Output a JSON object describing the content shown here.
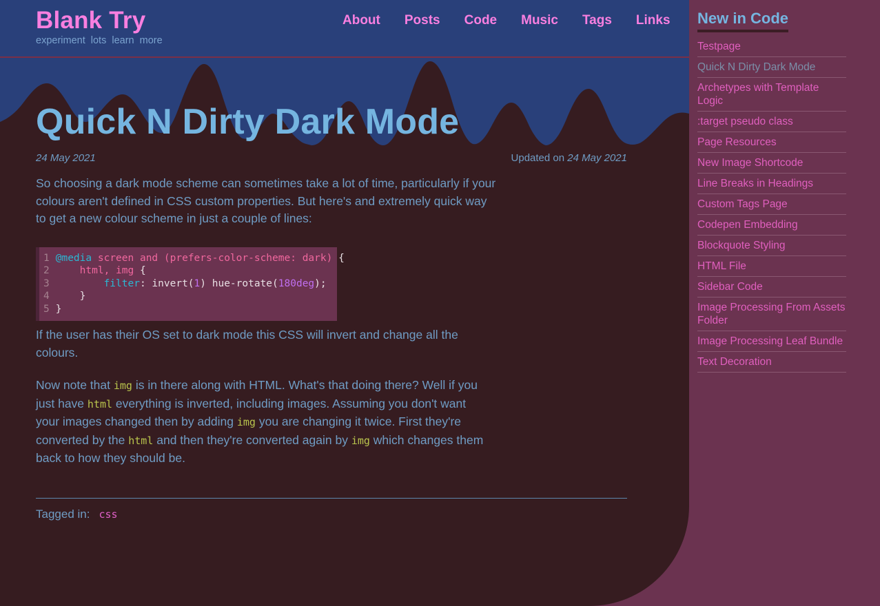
{
  "site": {
    "title": "Blank Try",
    "tagline": "experiment  lots  learn  more",
    "nav": [
      {
        "label": "About"
      },
      {
        "label": "Posts"
      },
      {
        "label": "Code"
      },
      {
        "label": "Music"
      },
      {
        "label": "Tags"
      },
      {
        "label": "Links"
      }
    ]
  },
  "post": {
    "title": "Quick N Dirty Dark Mode",
    "date": "24 May 2021",
    "updated_prefix": "Updated on ",
    "updated_date": "24 May 2021",
    "paragraph_1": "So choosing a dark mode scheme can sometimes take a lot of time, particularly if your colours aren't defined in CSS custom properties. But here's and extremely quick way to get a new colour scheme in just a couple of lines:",
    "paragraph_2": "If the user has their OS set to dark mode this CSS will invert and change all the colours.",
    "paragraph_3": {
      "s1": "Now note that ",
      "c1": "img",
      "s2": " is in there along with HTML. What's that doing there? Well if you just have ",
      "c2": "html",
      "s3": " everything is inverted, including images. Assuming you don't want your images changed then by adding ",
      "c3": "img",
      "s4": " you are changing it twice. First they're converted by the ",
      "c4": "html",
      "s5": " and then they're converted again by ",
      "c5": "img",
      "s6": " which changes them back to how they should be."
    },
    "tag_label": "Tagged in:",
    "tags": [
      {
        "label": "css"
      }
    ]
  },
  "code_block": {
    "language": "css",
    "line_numbers": "1\n2\n3\n4\n5",
    "lines": [
      {
        "n": "1",
        "tokens": [
          {
            "t": "@media",
            "c": "tok-at"
          },
          {
            "t": " ",
            "c": "tok-plain"
          },
          {
            "t": "screen and",
            "c": "tok-kw"
          },
          {
            "t": " ",
            "c": "tok-plain"
          },
          {
            "t": "(prefers-color-scheme: dark)",
            "c": "tok-kw"
          },
          {
            "t": " {",
            "c": "tok-plain"
          }
        ]
      },
      {
        "n": "2",
        "tokens": [
          {
            "t": "    ",
            "c": "tok-plain"
          },
          {
            "t": "html, img",
            "c": "tok-kw"
          },
          {
            "t": " {",
            "c": "tok-plain"
          }
        ]
      },
      {
        "n": "3",
        "tokens": [
          {
            "t": "        ",
            "c": "tok-plain"
          },
          {
            "t": "filter",
            "c": "tok-prop"
          },
          {
            "t": ": invert(",
            "c": "tok-plain"
          },
          {
            "t": "1",
            "c": "tok-num"
          },
          {
            "t": ") hue-rotate(",
            "c": "tok-plain"
          },
          {
            "t": "180deg",
            "c": "tok-num"
          },
          {
            "t": ");",
            "c": "tok-plain"
          }
        ]
      },
      {
        "n": "4",
        "tokens": [
          {
            "t": "    }",
            "c": "tok-plain"
          }
        ]
      },
      {
        "n": "5",
        "tokens": [
          {
            "t": "}",
            "c": "tok-plain"
          }
        ]
      }
    ]
  },
  "sidebar": {
    "heading": "New in Code",
    "items": [
      {
        "label": "Testpage",
        "current": false
      },
      {
        "label": "Quick N Dirty Dark Mode",
        "current": true
      },
      {
        "label": "Archetypes with Template Logic",
        "current": false
      },
      {
        "label": ":target pseudo class",
        "current": false
      },
      {
        "label": "Page Resources",
        "current": false
      },
      {
        "label": "New Image Shortcode",
        "current": false
      },
      {
        "label": "Line Breaks in Headings",
        "current": false
      },
      {
        "label": "Custom Tags Page",
        "current": false
      },
      {
        "label": "Codepen Embedding",
        "current": false
      },
      {
        "label": "Blockquote Styling",
        "current": false
      },
      {
        "label": "HTML File",
        "current": false
      },
      {
        "label": "Sidebar Code",
        "current": false
      },
      {
        "label": "Image Processing From Assets Folder",
        "current": false
      },
      {
        "label": "Image Processing Leaf Bundle",
        "current": false
      },
      {
        "label": "Text Decoration",
        "current": false
      }
    ]
  },
  "colors": {
    "header_bg": "#29407a",
    "article_bg": "#361c20",
    "sidebar_bg": "#6b3350",
    "brand_pink": "#f97fe0",
    "link_pink": "#e05fbe",
    "text_blue": "#6f9cc4",
    "heading_blue": "#75b5e0",
    "inline_code": "#b9c44d"
  }
}
